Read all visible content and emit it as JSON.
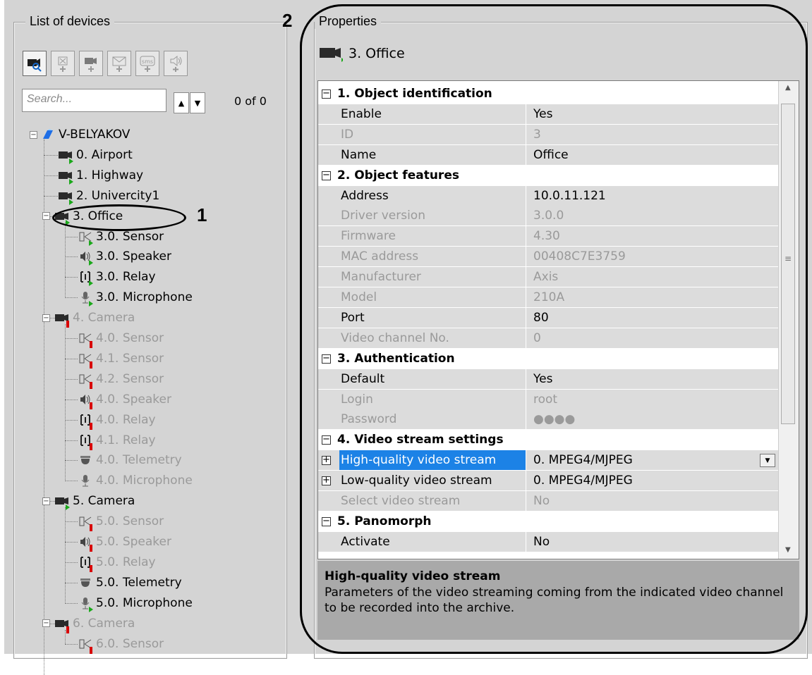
{
  "devices_panel": {
    "title": "List of devices",
    "toolbar": [
      {
        "name": "search-camera",
        "icon": "camera-search-icon"
      },
      {
        "name": "add-sensor",
        "icon": "add-sensor-icon"
      },
      {
        "name": "add-camera",
        "icon": "add-camera-icon"
      },
      {
        "name": "add-email",
        "icon": "add-email-icon"
      },
      {
        "name": "add-sms",
        "icon": "add-sms-icon",
        "label": "sms"
      },
      {
        "name": "add-speaker",
        "icon": "add-speaker-icon"
      }
    ],
    "search_placeholder": "Search...",
    "up_arrow": "^",
    "down_arrow": "v",
    "result_count": "0 of 0",
    "tree": [
      {
        "label": "V-BELYAKOV",
        "kind": "server",
        "level": 0,
        "expand": "−"
      },
      {
        "label": "0. Airport",
        "kind": "camera",
        "level": 1,
        "status": "ok"
      },
      {
        "label": "1. Highway",
        "kind": "camera",
        "level": 1,
        "status": "ok"
      },
      {
        "label": "2. Univercity1",
        "kind": "camera",
        "level": 1,
        "status": "ok"
      },
      {
        "label": "3. Office",
        "kind": "camera",
        "level": 1,
        "status": "ok",
        "expand": "−"
      },
      {
        "label": "3.0. Sensor",
        "kind": "sensor",
        "level": 2,
        "status": "ok"
      },
      {
        "label": "3.0. Speaker",
        "kind": "speaker",
        "level": 2,
        "status": "ok"
      },
      {
        "label": "3.0. Relay",
        "kind": "relay",
        "level": 2,
        "status": "ok"
      },
      {
        "label": "3.0. Microphone",
        "kind": "microphone",
        "level": 2,
        "status": "ok"
      },
      {
        "label": "4. Camera",
        "kind": "camera",
        "level": 1,
        "status": "off",
        "expand": "−",
        "dim": true
      },
      {
        "label": "4.0. Sensor",
        "kind": "sensor",
        "level": 2,
        "status": "off",
        "dim": true
      },
      {
        "label": "4.1. Sensor",
        "kind": "sensor",
        "level": 2,
        "status": "off",
        "dim": true
      },
      {
        "label": "4.2. Sensor",
        "kind": "sensor",
        "level": 2,
        "status": "off",
        "dim": true
      },
      {
        "label": "4.0. Speaker",
        "kind": "speaker",
        "level": 2,
        "status": "off",
        "dim": true
      },
      {
        "label": "4.0. Relay",
        "kind": "relay",
        "level": 2,
        "status": "off",
        "dim": true
      },
      {
        "label": "4.1. Relay",
        "kind": "relay",
        "level": 2,
        "status": "off",
        "dim": true
      },
      {
        "label": "4.0. Telemetry",
        "kind": "telemetry",
        "level": 2,
        "status": "none",
        "dim": true
      },
      {
        "label": "4.0. Microphone",
        "kind": "microphone",
        "level": 2,
        "status": "none",
        "dim": true
      },
      {
        "label": "5. Camera",
        "kind": "camera",
        "level": 1,
        "status": "ok",
        "expand": "−"
      },
      {
        "label": "5.0. Sensor",
        "kind": "sensor",
        "level": 2,
        "status": "off",
        "dim": true
      },
      {
        "label": "5.0. Speaker",
        "kind": "speaker",
        "level": 2,
        "status": "off",
        "dim": true
      },
      {
        "label": "5.0. Relay",
        "kind": "relay",
        "level": 2,
        "status": "off",
        "dim": true
      },
      {
        "label": "5.0. Telemetry",
        "kind": "telemetry",
        "level": 2,
        "status": "none"
      },
      {
        "label": "5.0. Microphone",
        "kind": "microphone",
        "level": 2,
        "status": "ok"
      },
      {
        "label": "6. Camera",
        "kind": "camera",
        "level": 1,
        "status": "off",
        "expand": "−",
        "dim": true
      },
      {
        "label": "6.0. Sensor",
        "kind": "sensor",
        "level": 2,
        "status": "off",
        "dim": true
      }
    ],
    "callout_number": "1"
  },
  "properties_panel": {
    "title": "Properties",
    "object_title": "3. Office",
    "callout_number": "2",
    "rows": [
      {
        "type": "section",
        "label": "1. Object identification",
        "toggle": "−"
      },
      {
        "type": "prop",
        "name": "Enable",
        "value": "Yes"
      },
      {
        "type": "prop",
        "name": "ID",
        "value": "3",
        "dim": true
      },
      {
        "type": "prop",
        "name": "Name",
        "value": "Office"
      },
      {
        "type": "section",
        "label": "2. Object features",
        "toggle": "−"
      },
      {
        "type": "prop",
        "name": "Address",
        "value": "10.0.11.121"
      },
      {
        "type": "prop",
        "name": "Driver version",
        "value": "3.0.0",
        "dim": true
      },
      {
        "type": "prop",
        "name": "Firmware",
        "value": "4.30",
        "dim": true
      },
      {
        "type": "prop",
        "name": "MAC address",
        "value": "00408C7E3759",
        "dim": true
      },
      {
        "type": "prop",
        "name": "Manufacturer",
        "value": "Axis",
        "dim": true
      },
      {
        "type": "prop",
        "name": "Model",
        "value": "210A",
        "dim": true
      },
      {
        "type": "prop",
        "name": "Port",
        "value": "80"
      },
      {
        "type": "prop",
        "name": "Video channel No.",
        "value": "0",
        "dim": true
      },
      {
        "type": "section",
        "label": "3. Authentication",
        "toggle": "−"
      },
      {
        "type": "prop",
        "name": "Default",
        "value": "Yes"
      },
      {
        "type": "prop",
        "name": "Login",
        "value": "root",
        "dim": true
      },
      {
        "type": "prop",
        "name": "Password",
        "value": "●●●●",
        "dim": true
      },
      {
        "type": "section",
        "label": "4. Video stream settings",
        "toggle": "−"
      },
      {
        "type": "prop",
        "name": "High-quality video stream",
        "value": "0. MPEG4/MJPEG",
        "expand": "+",
        "selected": true,
        "dropdown": "▼"
      },
      {
        "type": "prop",
        "name": "Low-quality video stream",
        "value": "0. MPEG4/MJPEG",
        "expand": "+"
      },
      {
        "type": "prop",
        "name": "Select video stream",
        "value": "No",
        "dim": true
      },
      {
        "type": "section",
        "label": "5. Panomorph",
        "toggle": "−"
      },
      {
        "type": "prop",
        "name": "Activate",
        "value": "No"
      }
    ],
    "scroll": {
      "up": "▲",
      "down": "▼",
      "grip": "≡"
    },
    "description": {
      "title": "High-quality video stream",
      "text": "Parameters of the video streaming coming from the indicated video channel to be recorded into the archive."
    }
  }
}
